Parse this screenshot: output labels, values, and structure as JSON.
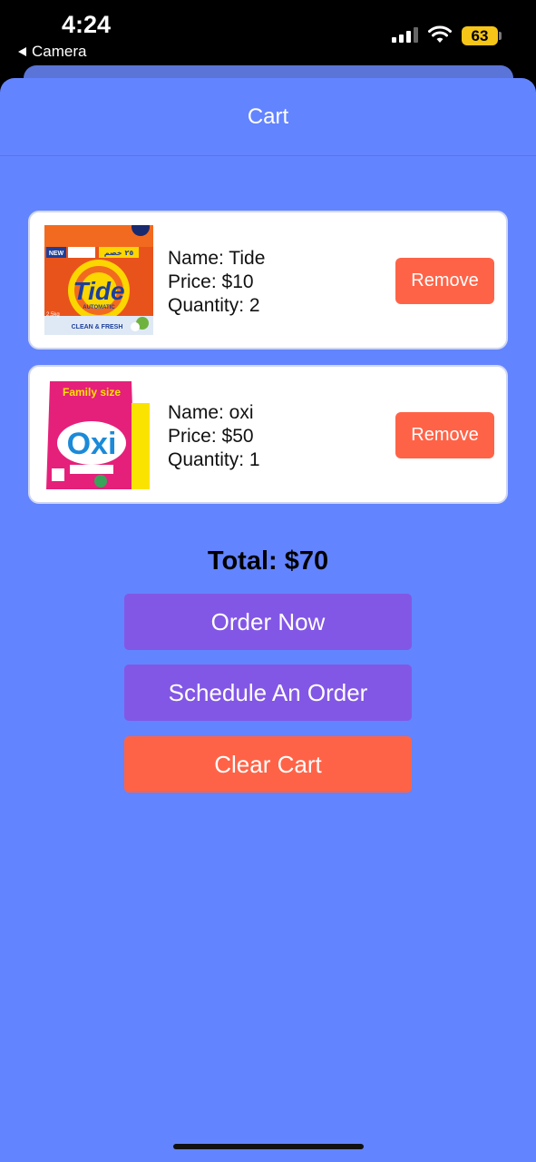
{
  "status_bar": {
    "time": "4:24",
    "back_app": "Camera",
    "battery": "63"
  },
  "header": {
    "title": "Cart"
  },
  "cart": {
    "items": [
      {
        "name_line": "Name: Tide",
        "price_line": "Price: $10",
        "quantity_line": "Quantity: 2",
        "remove_label": "Remove",
        "image": {
          "brand": "Tide",
          "sub": "AUTOMATIC",
          "badge": "NEW",
          "weight": "2.5kg",
          "tagline": "CLEAN & FRESH",
          "promo": "٢٥ خصم"
        }
      },
      {
        "name_line": "Name: oxi",
        "price_line": "Price: $50",
        "quantity_line": "Quantity: 1",
        "remove_label": "Remove",
        "image": {
          "brand": "Oxi",
          "banner": "Family size"
        }
      }
    ]
  },
  "total": "Total: $70",
  "actions": {
    "order_now": "Order Now",
    "schedule": "Schedule An Order",
    "clear": "Clear Cart"
  },
  "colors": {
    "background": "#6384ff",
    "purple_button": "#8257e5",
    "remove_button": "#ff6347"
  }
}
